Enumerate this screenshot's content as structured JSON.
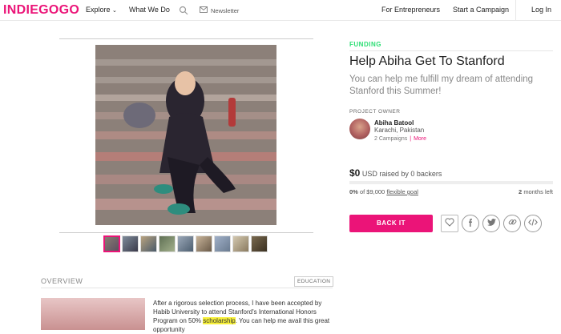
{
  "nav": {
    "logo": "INDIEGOGO",
    "explore": "Explore",
    "what_we_do": "What We Do",
    "newsletter": "Newsletter",
    "for_entrepreneurs": "For Entrepreneurs",
    "start_campaign": "Start a Campaign",
    "login": "Log In"
  },
  "campaign": {
    "category_label": "FUNDING",
    "title": "Help Abiha Get To Stanford",
    "tagline": "You can help me fulfill my dream of attending Stanford this Summer!",
    "owner_label": "PROJECT OWNER",
    "owner_name": "Abiha Batool",
    "owner_location": "Karachi, Pakistan",
    "owner_campaigns": "2 Campaigns",
    "owner_sep": "|",
    "owner_more": "More",
    "raised_amount": "$0",
    "raised_text": "USD raised by 0 backers",
    "pct": "0%",
    "pct_of": "of $9,000",
    "goal_type": "flexible goal",
    "days_num": "2",
    "days_unit": "months left",
    "progress": 0,
    "back_button": "BACK IT"
  },
  "gallery": {
    "thumb_count": 9,
    "active_index": 0
  },
  "overview": {
    "label": "OVERVIEW",
    "tag": "EDUCATION",
    "text_before": "After a rigorous selection process, I have been accepted by Habib University to attend Stanford's International Honors Program on 50% ",
    "text_highlight": "scholarship",
    "text_after": ". You can help me avail this great opportunity"
  },
  "colors": {
    "brand": "#eb1478",
    "funding": "#2bde73"
  },
  "icons": [
    "search-icon",
    "envelope-icon",
    "chevron-down-icon",
    "heart-icon",
    "facebook-icon",
    "twitter-icon",
    "link-icon",
    "embed-icon"
  ]
}
